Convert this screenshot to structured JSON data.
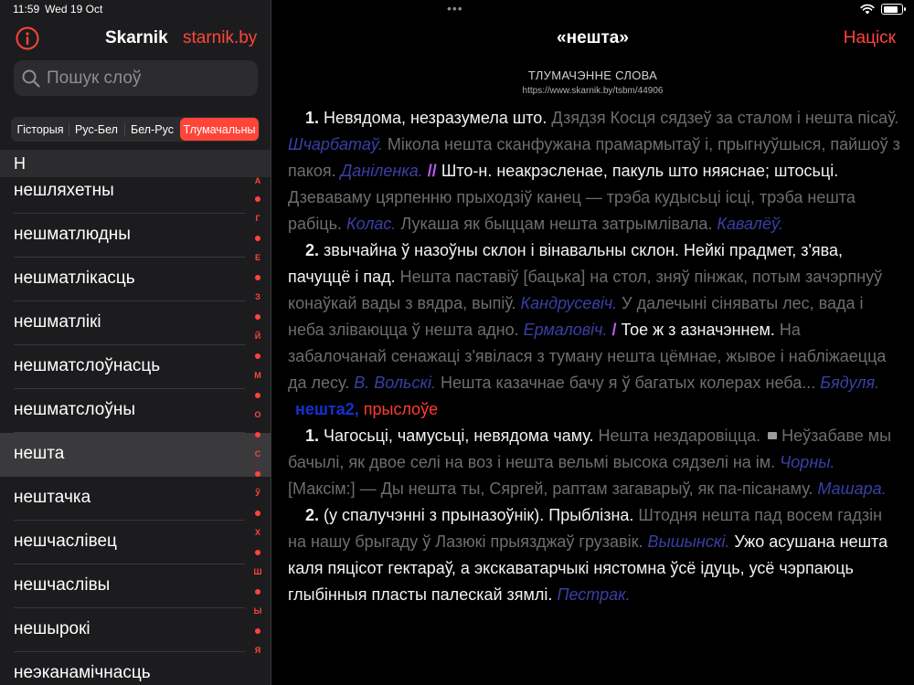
{
  "status": {
    "time": "11:59",
    "date": "Wed 19 Oct",
    "battery_level": 0.85
  },
  "sidebar": {
    "title": "Skarnik",
    "link": "starnik.by",
    "search_placeholder": "Пошук слоў",
    "segments": [
      "Гісторыя",
      "Рус-Бел",
      "Бел-Рус",
      "Тлумачальны"
    ],
    "active_segment": 3,
    "section_letter": "Н",
    "words": [
      "нешляхетны",
      "нешматлюдны",
      "нешматлікасць",
      "нешматлікі",
      "нешматслоўнасць",
      "нешматслоўны",
      "нешта",
      "нештачка",
      "нешчаслівец",
      "нешчаслівы",
      "нешырокі",
      "неэканамічнасць"
    ],
    "selected_word": 6,
    "index_letters": [
      "А",
      "Г",
      "Е",
      "З",
      "Й",
      "М",
      "О",
      "С",
      "Ў",
      "Х",
      "Ш",
      "Ы",
      "Я"
    ]
  },
  "main": {
    "nav_title": "«нешта»",
    "back_label": "Націск",
    "dict_title": "ТЛУМАЧЭННЕ СЛОВА",
    "dict_url": "https://www.skarnik.by/tsbm/44906",
    "entry": {
      "s1": {
        "num": "1.",
        "def": "Невядома, незразумела што.",
        "ex1": "Дзядзя Косця сядзеў за сталом і нешта пісаў.",
        "au1": "Шчарбатаў.",
        "ex2": "Мікола нешта сканфужана прамармытаў і, прыгнуўшыся, пайшоў з пакоя.",
        "au2": "Даніленка.",
        "mark": "//",
        "subdef": "Што-н. неакрэсленае, пакуль што няяснае; штосьці.",
        "ex3": "Дзеваваму цярпенню прыходзіў канец — трэба кудысьці ісці, трэба нешта рабіць.",
        "au3": "Колас.",
        "ex4": "Лукаша як быццам нешта затрымлівала.",
        "au4": "Кавалёў."
      },
      "s2": {
        "num": "2.",
        "def": "звычайна ў назоўны склон і вінавальны склон. Нейкі прадмет, з'ява, пачуццё і пад.",
        "ex1": "Нешта паставіў [бацька] на стол, зняў пінжак, потым зачэрпнуў конаўкай вады з вядра, выпіў.",
        "au1": "Кандрусевіч.",
        "ex2": "У далечыні сіняваты лес, вада і неба зліваюцца ў нешта адно.",
        "au2": "Ермаловіч.",
        "mark": "/",
        "subdef": "Тое ж з азначэннем.",
        "ex3": "На забалочанай сенажаці з'явілася з туману нешта цёмнае, жывое і набліжаецца да лесу.",
        "au3": "В. Вольскі.",
        "ex4": "Нешта казачнае бачу я ў багатых колерах неба...",
        "au4": "Бядуля."
      },
      "head2": {
        "word": "нешта2,",
        "pos": "прыслоўе"
      },
      "s3": {
        "num": "1.",
        "def": "Чагосьці, чамусьці, невядома чаму.",
        "ex1": "Нешта нездаровіцца.",
        "ex2": "Неўзабаве мы бачылі, як двое селі на воз і нешта вельмі высока сядзелі на ім.",
        "au2": "Чорны.",
        "ex3": "[Максім:] — Ды нешта ты, Сяргей, раптам загаварыў, як па-пісанаму.",
        "au3": "Машара."
      },
      "s4": {
        "num": "2.",
        "def": "(у спалучэнні з прыназоўнік). Прыблізна.",
        "ex1": "Штодня нешта пад восем гадзін на нашу брыгаду ў Лазюкі прыязджаў грузавік.",
        "au1": "Вышынскі.",
        "ex2": "Ужо асушана нешта каля пяцісот гектараў, а экскаватарчыкі нястомна ўсё ідуць, усё чэрпаюць глыбінныя пласты палескай зямлі.",
        "au2": "Пестрак."
      }
    }
  },
  "colors": {
    "accent": "#ff453a",
    "author": "#3b3fa5",
    "example": "#6d6d72",
    "marker": "#bf5af2",
    "headword": "#1531d1"
  },
  "icons": {
    "info": "info-circle-icon",
    "search": "magnifier-icon",
    "wifi": "wifi-icon",
    "battery": "battery-icon",
    "note": "note-icon"
  }
}
